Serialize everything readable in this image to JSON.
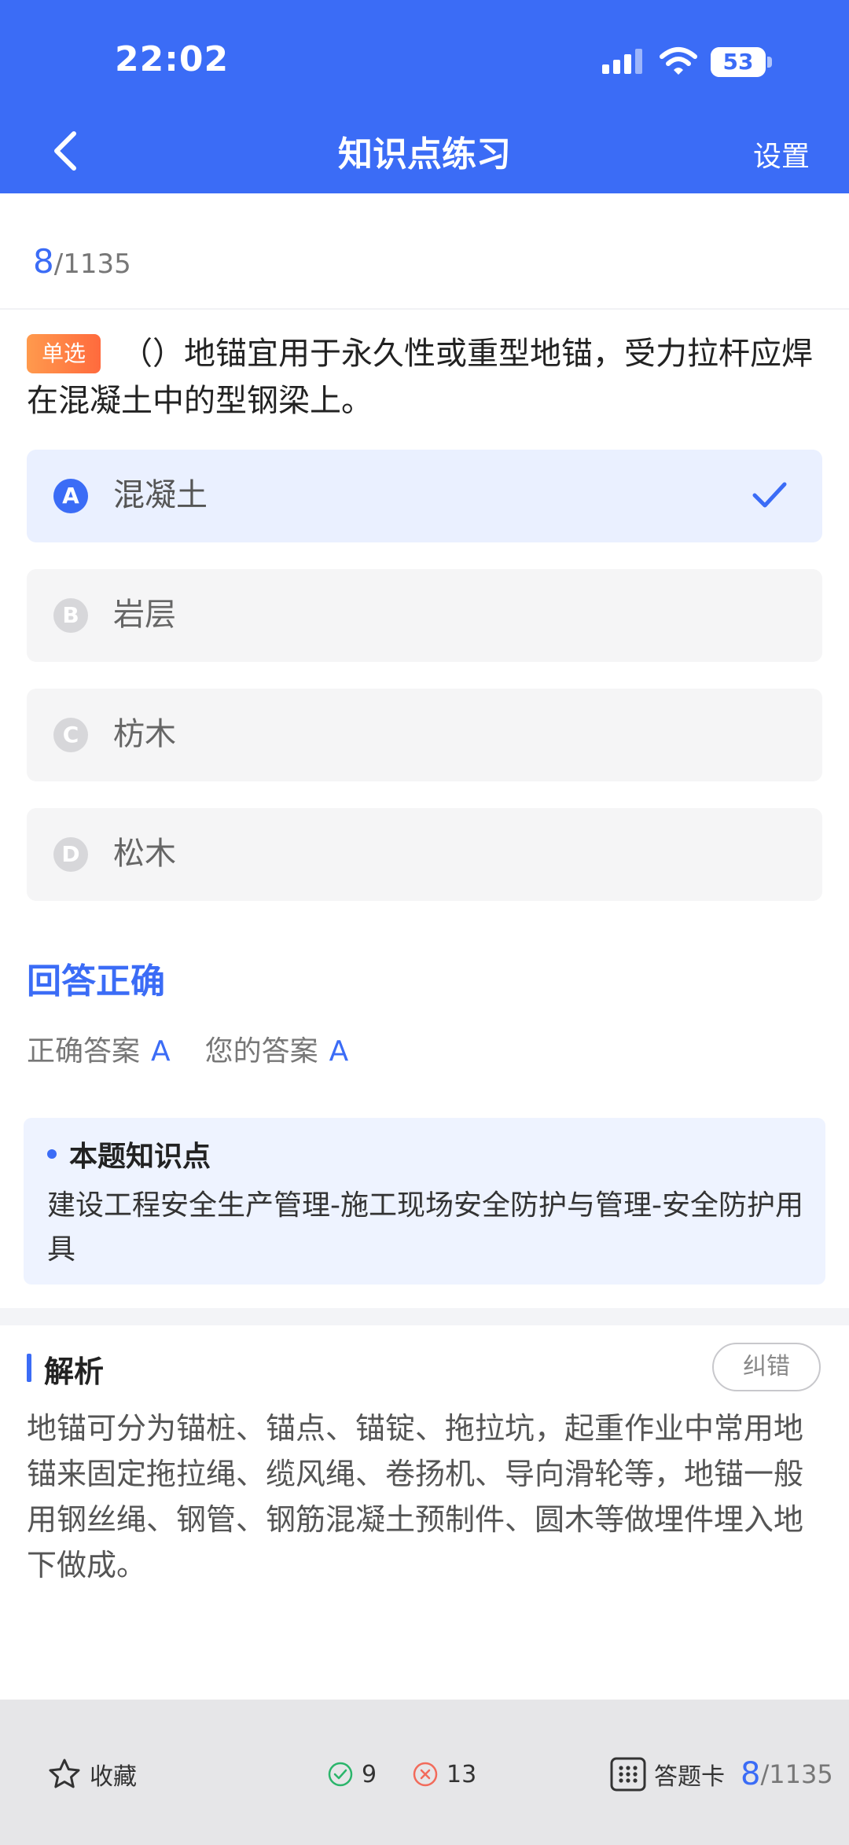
{
  "status": {
    "time": "22:02",
    "battery": "53",
    "battery_level": 53
  },
  "nav": {
    "title": "知识点练习",
    "settings": "设置"
  },
  "progress": {
    "current": "8",
    "total": "/1135"
  },
  "question": {
    "tag": "单选",
    "text": "（）地锚宜用于永久性或重型地锚，受力拉杆应焊在混凝土中的型钢梁上。"
  },
  "options": [
    {
      "letter": "A",
      "text": "混凝土",
      "selected": true
    },
    {
      "letter": "B",
      "text": "岩层",
      "selected": false
    },
    {
      "letter": "C",
      "text": "枋木",
      "selected": false
    },
    {
      "letter": "D",
      "text": "松木",
      "selected": false
    }
  ],
  "result": {
    "title": "回答正确",
    "correct_label": "正确答案",
    "correct_value": "A",
    "your_label": "您的答案",
    "your_value": "A"
  },
  "knowledge": {
    "title": "本题知识点",
    "text": "建设工程安全生产管理-施工现场安全防护与管理-安全防护用具"
  },
  "analysis": {
    "title": "解析",
    "report_label": "纠错",
    "text": "地锚可分为锚桩、锚点、锚锭、拖拉坑，起重作业中常用地锚来固定拖拉绳、缆风绳、卷扬机、导向滑轮等，地锚一般用钢丝绳、钢管、钢筋混凝土预制件、圆木等做埋件埋入地下做成。"
  },
  "bottom": {
    "favorite": "收藏",
    "right_count": "9",
    "wrong_count": "13",
    "card": "答题卡",
    "current": "8",
    "total": "/1135"
  },
  "colors": {
    "primary": "#3b6cf6",
    "tag_start": "#ff9a4d",
    "tag_end": "#ff6a3d",
    "right": "#2bb56b",
    "wrong": "#f26b5b"
  }
}
